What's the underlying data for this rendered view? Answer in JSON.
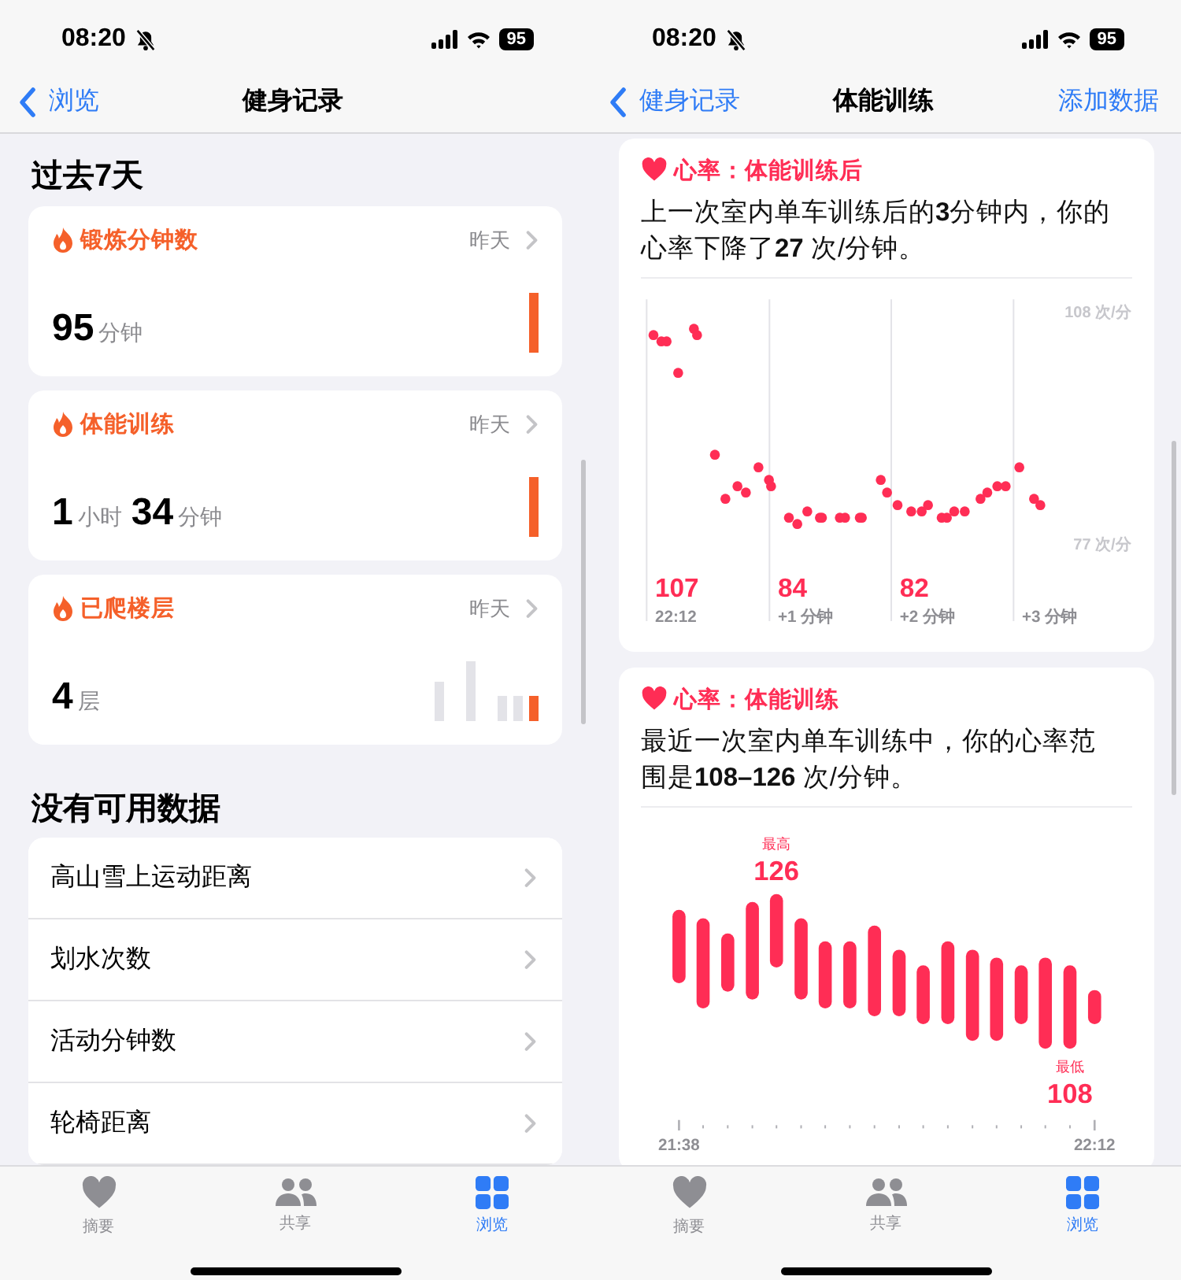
{
  "screens": [
    {
      "status_bar": {
        "time": "08:20",
        "battery": "95"
      },
      "nav": {
        "back": "浏览",
        "title": "健身记录"
      },
      "sections": [
        {
          "kind": "cards",
          "title": "过去7天",
          "cards": [
            {
              "title": "锻炼分钟数",
              "date": "昨天",
              "value_parts": [
                {
                  "text": "95",
                  "kind": "number"
                },
                {
                  "text": "分钟",
                  "kind": "unit"
                }
              ]
            },
            {
              "title": "体能训练",
              "date": "昨天",
              "value_parts": [
                {
                  "text": "1",
                  "kind": "number"
                },
                {
                  "text": "小时",
                  "kind": "unit"
                },
                {
                  "text": "34",
                  "kind": "number"
                },
                {
                  "text": "分钟",
                  "kind": "unit"
                }
              ]
            },
            {
              "title": "已爬楼层",
              "date": "昨天",
              "value_parts": [
                {
                  "text": "4",
                  "kind": "number"
                },
                {
                  "text": "层",
                  "kind": "unit"
                }
              ]
            }
          ]
        },
        {
          "kind": "list",
          "title": "没有可用数据",
          "items": [
            "高山雪上运动距离",
            "划水次数",
            "活动分钟数",
            "轮椅距离"
          ]
        }
      ],
      "tab_bar": [
        {
          "label": "摘要",
          "selected": false
        },
        {
          "label": "共享",
          "selected": false
        },
        {
          "label": "浏览",
          "selected": true
        }
      ]
    },
    {
      "status_bar": {
        "time": "08:20",
        "battery": "95"
      },
      "nav": {
        "back": "健身记录",
        "title": "体能训练",
        "action": "添加数据"
      },
      "cards": [
        {
          "kind": "scatter",
          "title": "心率：体能训练后",
          "summary": "上一次室内单车训练后的**3**分钟内，你的心率下降了**27** 次/分钟。",
          "scale_top": "108 次/分",
          "scale_bottom": "77 次/分",
          "columns": [
            {
              "reading": "107",
              "label": "22:12"
            },
            {
              "reading": "84",
              "label": "+1 分钟"
            },
            {
              "reading": "82",
              "label": "+2 分钟"
            },
            {
              "label": "+3 分钟"
            }
          ]
        },
        {
          "kind": "range_bars",
          "title": "心率：体能训练",
          "summary": "最近一次室内单车训练中，你的心率范围是**108–126** 次/分钟。",
          "high_label": "最高",
          "high": "126",
          "low_label": "最低",
          "low": "108",
          "axis_start": "21:38",
          "axis_end": "22:12"
        }
      ],
      "tab_bar": [
        {
          "label": "摘要",
          "selected": false
        },
        {
          "label": "共享",
          "selected": false
        },
        {
          "label": "浏览",
          "selected": true
        }
      ]
    }
  ]
}
